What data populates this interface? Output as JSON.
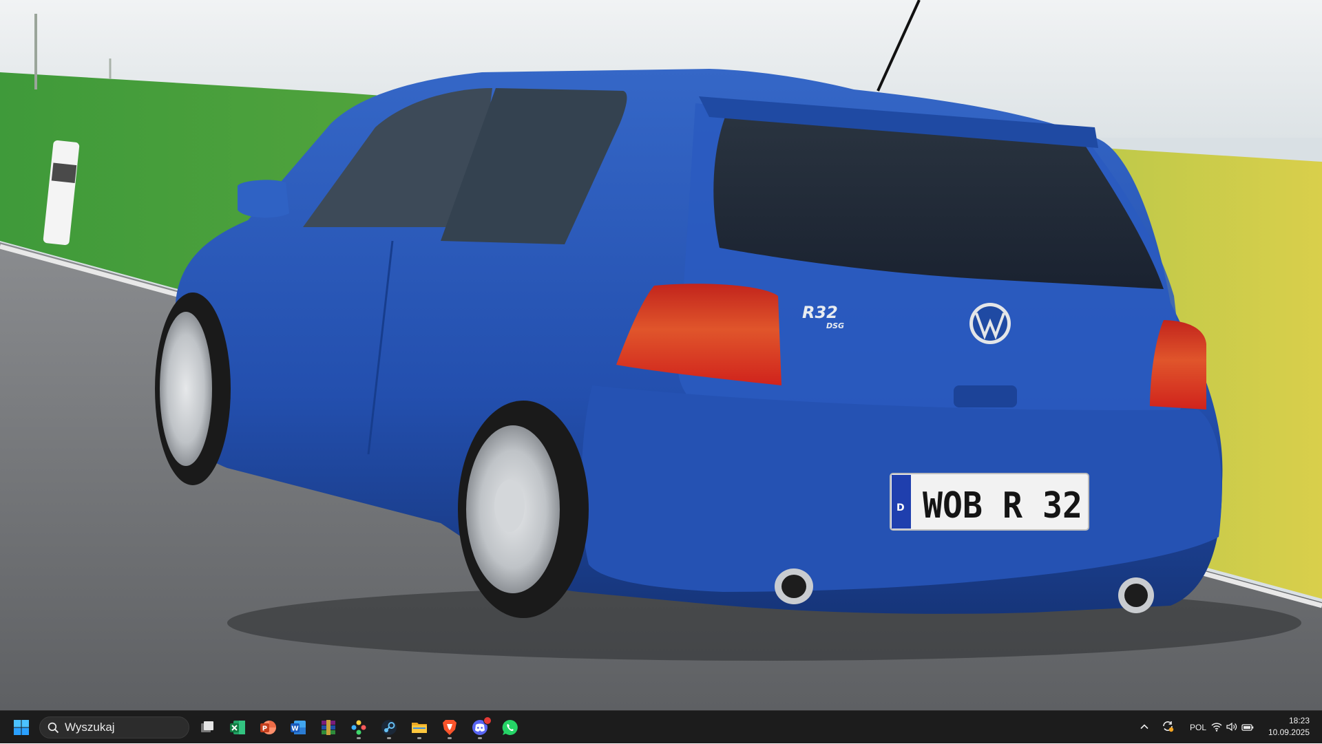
{
  "wallpaper": {
    "plate_text": "WOB R 32",
    "plate_country": "D",
    "badge_model": "R32",
    "badge_sub": "DSG",
    "car_color": "#2a57b8"
  },
  "taskbar": {
    "search_placeholder": "Wyszukaj",
    "pinned": [
      {
        "name": "start-button",
        "icon": "windows-logo-icon"
      },
      {
        "name": "task-view-button",
        "icon": "task-view-icon"
      },
      {
        "name": "excel-button",
        "icon": "excel-icon"
      },
      {
        "name": "powerpoint-button",
        "icon": "powerpoint-icon"
      },
      {
        "name": "word-button",
        "icon": "word-icon"
      },
      {
        "name": "winrar-button",
        "icon": "winrar-icon"
      },
      {
        "name": "games-launcher-button",
        "icon": "gamepad-icon"
      },
      {
        "name": "steam-button",
        "icon": "steam-icon"
      },
      {
        "name": "file-explorer-button",
        "icon": "folder-icon"
      },
      {
        "name": "brave-button",
        "icon": "brave-icon"
      },
      {
        "name": "discord-button",
        "icon": "discord-icon"
      },
      {
        "name": "whatsapp-button",
        "icon": "whatsapp-icon"
      }
    ],
    "tray": {
      "language": "POL",
      "time": "18:23",
      "date": "10.09.2025"
    }
  },
  "colors": {
    "taskbar_bg": "#1c1c1c",
    "accent": "#0078d4",
    "notification": "#e53935"
  }
}
